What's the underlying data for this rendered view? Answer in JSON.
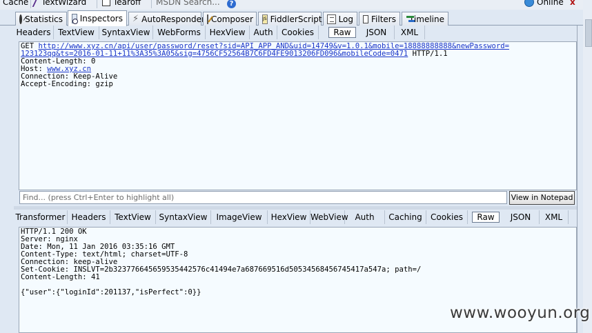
{
  "toolbar": {
    "cache_label": "Cache",
    "textwizard_label": "TextWizard",
    "tearoff_label": "Tearoff",
    "msdn_label": "MSDN Search...",
    "online_label": "Online",
    "close_label": "x"
  },
  "main_tabs": [
    {
      "label": "Statistics",
      "icon": "stopwatch-icon"
    },
    {
      "label": "Inspectors",
      "icon": "inspectors-icon"
    },
    {
      "label": "AutoResponder",
      "icon": "lightning-icon"
    },
    {
      "label": "Composer",
      "icon": "composer-icon"
    },
    {
      "label": "FiddlerScript",
      "icon": "script-icon"
    },
    {
      "label": "Log",
      "icon": "log-icon"
    },
    {
      "label": "Filters",
      "icon": "checkbox-icon"
    },
    {
      "label": "Timeline",
      "icon": "timeline-icon"
    }
  ],
  "request_tabs": [
    "Headers",
    "TextView",
    "SyntaxView",
    "WebForms",
    "HexView",
    "Auth",
    "Cookies",
    "Raw",
    "JSON",
    "XML"
  ],
  "request": {
    "method": "GET ",
    "url_line1": "http://www.xyz.cn/api/user/password/reset?sid=API_APP_AND&uid=14749&v=1.0.1&mobile=18888888888&newPassword=",
    "url_line2": "123123qq&ts=2016-01-11+11%3A35%3A05&sig=4756CF52564B7C6FD4FE9013206FD096&mobileCode=0471",
    "protocol": " HTTP/1.1",
    "content_length": "Content-Length: 0",
    "host_label": "Host: ",
    "host_value": "www.xyz.cn",
    "connection": "Connection: Keep-Alive",
    "accept_encoding": "Accept-Encoding: gzip"
  },
  "find": {
    "placeholder": "Find... (press Ctrl+Enter to highlight all)",
    "button_label": "View in Notepad"
  },
  "response_tabs": [
    "Transformer",
    "Headers",
    "TextView",
    "SyntaxView",
    "ImageView",
    "HexView",
    "WebView",
    "Auth",
    "Caching",
    "Cookies",
    "Raw",
    "JSON",
    "XML"
  ],
  "response": {
    "status": "HTTP/1.1 200 OK",
    "server": "Server: nginx",
    "date": "Date: Mon, 11 Jan 2016 03:35:16 GMT",
    "content_type": "Content-Type: text/html; charset=UTF-8",
    "connection": "Connection: keep-alive",
    "set_cookie": "Set-Cookie: INSLVT=2b32377664565953544257 6c41494e7a687669516d5053456845 6745417a547a; path=/",
    "content_length": "Content-Length: 41",
    "body": "{\"user\":{\"loginId\":201137,\"isPerfect\":0}}"
  },
  "watermark": "www.wooyun.org",
  "colors": {
    "background": "#dfe8f3",
    "pane": "#f5fbff",
    "link": "#1a35c8"
  }
}
